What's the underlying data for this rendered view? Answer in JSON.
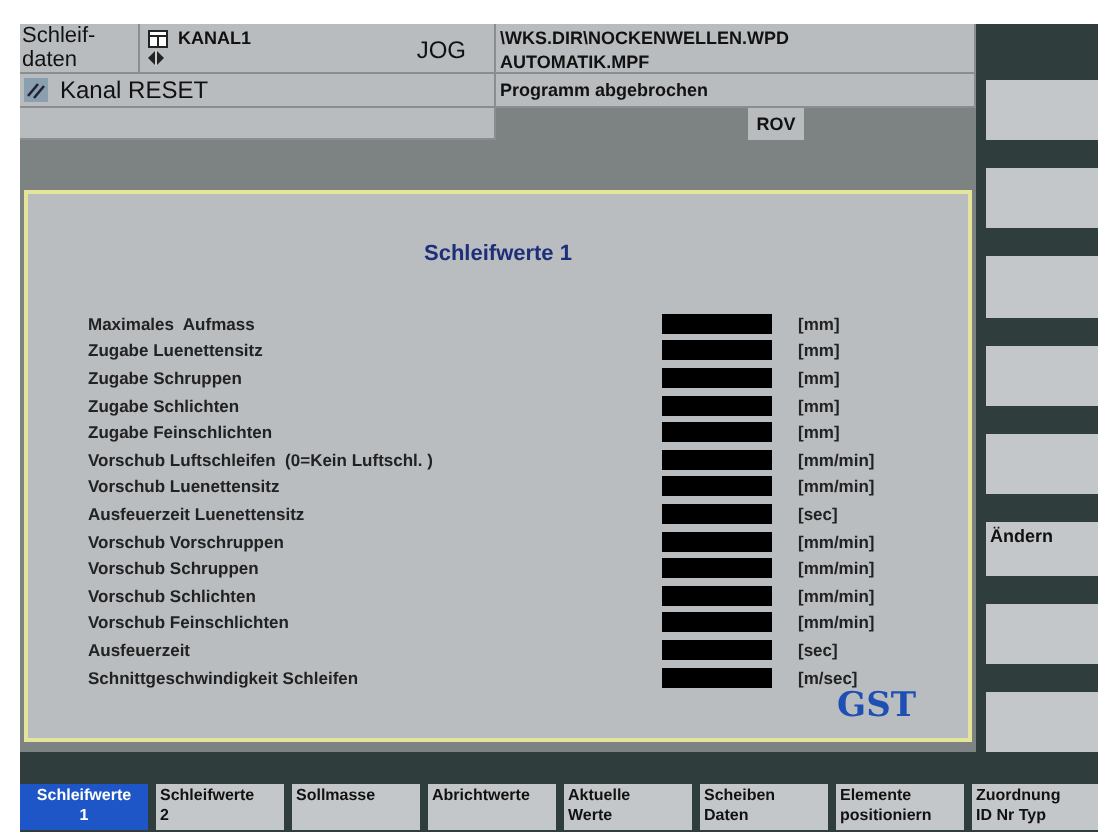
{
  "header": {
    "area": "Schleif-\ndaten",
    "channel": "KANAL1",
    "mode": "JOG",
    "program_path": "\\WKS.DIR\\NOCKENWELLEN.WPD",
    "program_file": "AUTOMATIK.MPF",
    "channel_status": "Kanal RESET",
    "program_status": "Programm abgebrochen",
    "override": "ROV"
  },
  "panel": {
    "title": "Schleifwerte 1",
    "logo": "GST",
    "params": [
      {
        "label": "Maximales  Aufmass",
        "unit": "[mm]"
      },
      {
        "label": "Zugabe Luenettensitz",
        "unit": "[mm]"
      },
      {
        "label": "Zugabe Schruppen",
        "unit": "[mm]"
      },
      {
        "label": "Zugabe Schlichten",
        "unit": "[mm]"
      },
      {
        "label": "Zugabe Feinschlichten",
        "unit": "[mm]"
      },
      {
        "label": "Vorschub Luftschleifen  (0=Kein Luftschl. )",
        "unit": "[mm/min]"
      },
      {
        "label": "Vorschub Luenettensitz",
        "unit": "[mm/min]"
      },
      {
        "label": "Ausfeuerzeit Luenettensitz",
        "unit": "[sec]"
      },
      {
        "label": "Vorschub Vorschruppen",
        "unit": "[mm/min]"
      },
      {
        "label": "Vorschub Schruppen",
        "unit": "[mm/min]"
      },
      {
        "label": "Vorschub Schlichten",
        "unit": "[mm/min]"
      },
      {
        "label": "Vorschub Feinschlichten",
        "unit": "[mm/min]"
      },
      {
        "label": "Ausfeuerzeit",
        "unit": "[sec]"
      },
      {
        "label": "Schnittgeschwindigkeit Schleifen",
        "unit": "[m/sec]"
      }
    ]
  },
  "vertical_softkeys": [
    {
      "kind": "blank"
    },
    {
      "kind": "blank"
    },
    {
      "kind": "blank"
    },
    {
      "kind": "blank"
    },
    {
      "kind": "blank"
    },
    {
      "kind": "labeled",
      "label": "Ändern"
    },
    {
      "kind": "blank"
    },
    {
      "kind": "blank"
    }
  ],
  "horizontal_softkeys": [
    {
      "label": "Schleifwerte\n1",
      "selected": true
    },
    {
      "label": "Schleifwerte\n2",
      "selected": false
    },
    {
      "label": "Sollmasse",
      "selected": false
    },
    {
      "label": "Abrichtwerte",
      "selected": false
    },
    {
      "label": "Aktuelle\nWerte",
      "selected": false
    },
    {
      "label": "Scheiben\nDaten",
      "selected": false
    },
    {
      "label": "Elemente\npositioniern",
      "selected": false
    },
    {
      "label": "Zuordnung\nID Nr Typ",
      "selected": false
    }
  ]
}
